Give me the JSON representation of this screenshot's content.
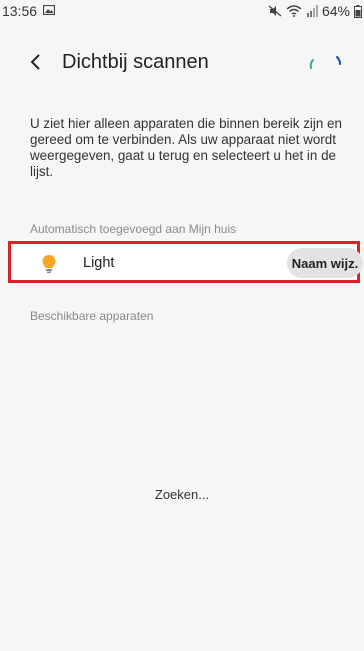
{
  "status_bar": {
    "time": "13:56",
    "battery": "64%",
    "icons": [
      "image-icon",
      "mute-icon",
      "wifi-icon",
      "signal-icon",
      "battery-icon"
    ]
  },
  "header": {
    "title": "Dichtbij scannen",
    "back_icon": "chevron-left-icon",
    "accent_color": "#3aa6a0"
  },
  "description": "U ziet hier alleen apparaten die binnen bereik zijn en gereed om te verbinden. Als uw apparaat niet wordt weergegeven, gaat u terug en selecteert u het in de lijst.",
  "section_added": {
    "label": "Automatisch toegevoegd aan Mijn huis",
    "devices": [
      {
        "name": "Light",
        "icon": "lightbulb-icon",
        "icon_color": "#f5a623",
        "action": "Naam wijz."
      }
    ]
  },
  "section_available": {
    "label": "Beschikbare apparaten"
  },
  "status": "Zoeken...",
  "highlight_color": "#d8232a"
}
